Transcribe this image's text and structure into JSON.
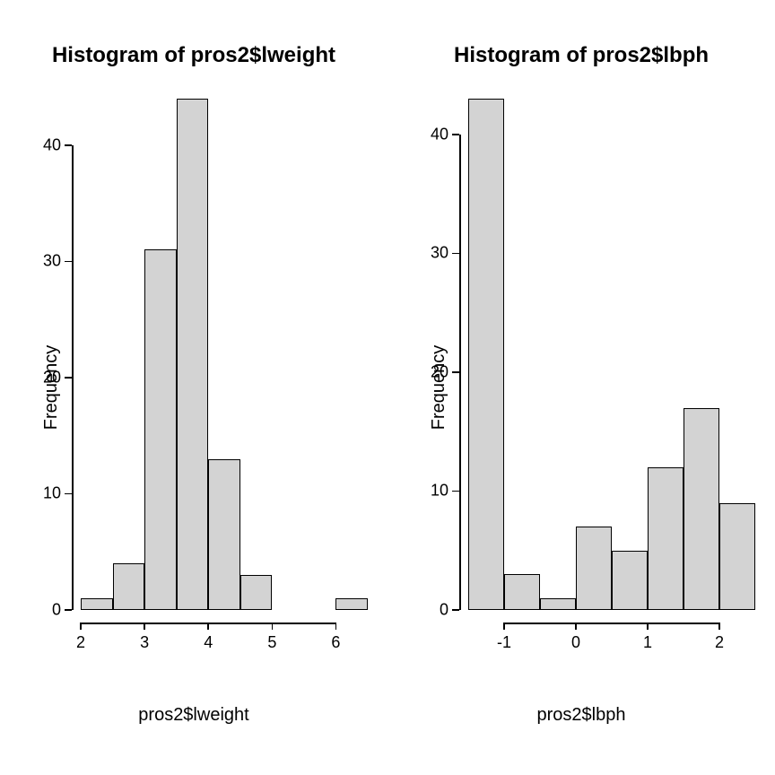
{
  "chart_data": [
    {
      "type": "bar",
      "title": "Histogram of pros2$lweight",
      "xlabel": "pros2$lweight",
      "ylabel": "Frequency",
      "bins": [
        {
          "x0": 2.0,
          "x1": 2.5,
          "count": 1
        },
        {
          "x0": 2.5,
          "x1": 3.0,
          "count": 4
        },
        {
          "x0": 3.0,
          "x1": 3.5,
          "count": 31
        },
        {
          "x0": 3.5,
          "x1": 4.0,
          "count": 44
        },
        {
          "x0": 4.0,
          "x1": 4.5,
          "count": 13
        },
        {
          "x0": 4.5,
          "x1": 5.0,
          "count": 3
        },
        {
          "x0": 5.0,
          "x1": 5.5,
          "count": 0
        },
        {
          "x0": 5.5,
          "x1": 6.0,
          "count": 0
        },
        {
          "x0": 6.0,
          "x1": 6.5,
          "count": 1
        }
      ],
      "xlim": [
        2,
        6.5
      ],
      "ylim": [
        0,
        44
      ],
      "xticks": [
        2,
        3,
        4,
        5,
        6
      ],
      "yticks": [
        0,
        10,
        20,
        30,
        40
      ]
    },
    {
      "type": "bar",
      "title": "Histogram of pros2$lbph",
      "xlabel": "pros2$lbph",
      "ylabel": "Frequency",
      "bins": [
        {
          "x0": -1.5,
          "x1": -1.0,
          "count": 43
        },
        {
          "x0": -1.0,
          "x1": -0.5,
          "count": 3
        },
        {
          "x0": -0.5,
          "x1": 0.0,
          "count": 1
        },
        {
          "x0": 0.0,
          "x1": 0.5,
          "count": 7
        },
        {
          "x0": 0.5,
          "x1": 1.0,
          "count": 5
        },
        {
          "x0": 1.0,
          "x1": 1.5,
          "count": 12
        },
        {
          "x0": 1.5,
          "x1": 2.0,
          "count": 17
        },
        {
          "x0": 2.0,
          "x1": 2.5,
          "count": 9
        }
      ],
      "xlim": [
        -1.5,
        2.5
      ],
      "ylim": [
        0,
        43
      ],
      "xticks": [
        -1,
        0,
        1,
        2
      ],
      "yticks": [
        0,
        10,
        20,
        30,
        40
      ]
    }
  ]
}
